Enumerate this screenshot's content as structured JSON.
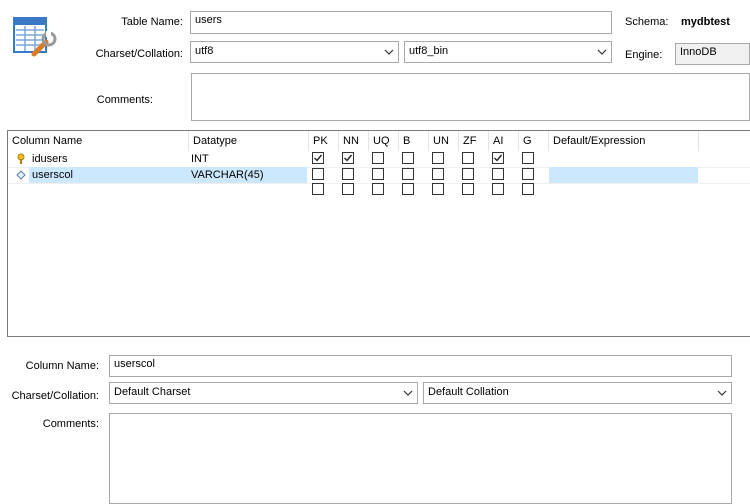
{
  "top": {
    "table_name_label": "Table Name:",
    "table_name_value": "users",
    "schema_label": "Schema:",
    "schema_value": "mydbtest",
    "charset_label": "Charset/Collation:",
    "charset_value": "utf8",
    "collation_value": "utf8_bin",
    "engine_label": "Engine:",
    "engine_value": "InnoDB",
    "comments_label": "Comments:",
    "comments_value": ""
  },
  "columns_grid": {
    "headers": [
      "Column Name",
      "Datatype",
      "PK",
      "NN",
      "UQ",
      "B",
      "UN",
      "ZF",
      "AI",
      "G",
      "Default/Expression"
    ],
    "rows": [
      {
        "name": "idusers",
        "icon": "primary-key-icon",
        "datatype": "INT",
        "flags": [
          true,
          true,
          false,
          false,
          false,
          false,
          true,
          false
        ],
        "default": "",
        "selected": false
      },
      {
        "name": "userscol",
        "icon": "column-diamond-icon",
        "datatype": "VARCHAR(45)",
        "flags": [
          false,
          false,
          false,
          false,
          false,
          false,
          false,
          false
        ],
        "default": "",
        "selected": true
      },
      {
        "name": "",
        "icon": "",
        "datatype": "",
        "flags": [
          false,
          false,
          false,
          false,
          false,
          false,
          false,
          false
        ],
        "default": "",
        "selected": false
      }
    ]
  },
  "column_details": {
    "column_name_label": "Column Name:",
    "column_name_value": "userscol",
    "charset_label": "Charset/Collation:",
    "charset_value": "Default Charset",
    "collation_value": "Default Collation",
    "comments_label": "Comments:",
    "comments_value": ""
  },
  "colors": {
    "selection": "#cce8ff",
    "border": "#a9a9a9",
    "grid_border": "#7a7a7a",
    "engine_bg": "#f0f0f0"
  }
}
